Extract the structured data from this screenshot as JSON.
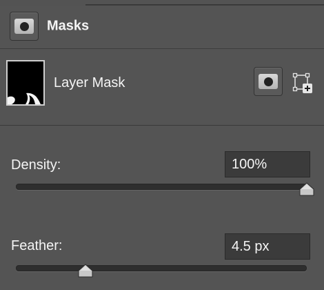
{
  "panel": {
    "title": "Masks",
    "mask_icon": "pixel-mask-icon"
  },
  "layer": {
    "name": "Layer Mask",
    "thumbnail": "layer-mask-thumbnail",
    "icons": [
      "pixel-mask-icon",
      "vector-mask-add-icon"
    ]
  },
  "density": {
    "label": "Density:",
    "value": "100%",
    "slider_fraction": 1.0
  },
  "feather": {
    "label": "Feather:",
    "value": "4.5 px",
    "slider_fraction": 0.24
  }
}
